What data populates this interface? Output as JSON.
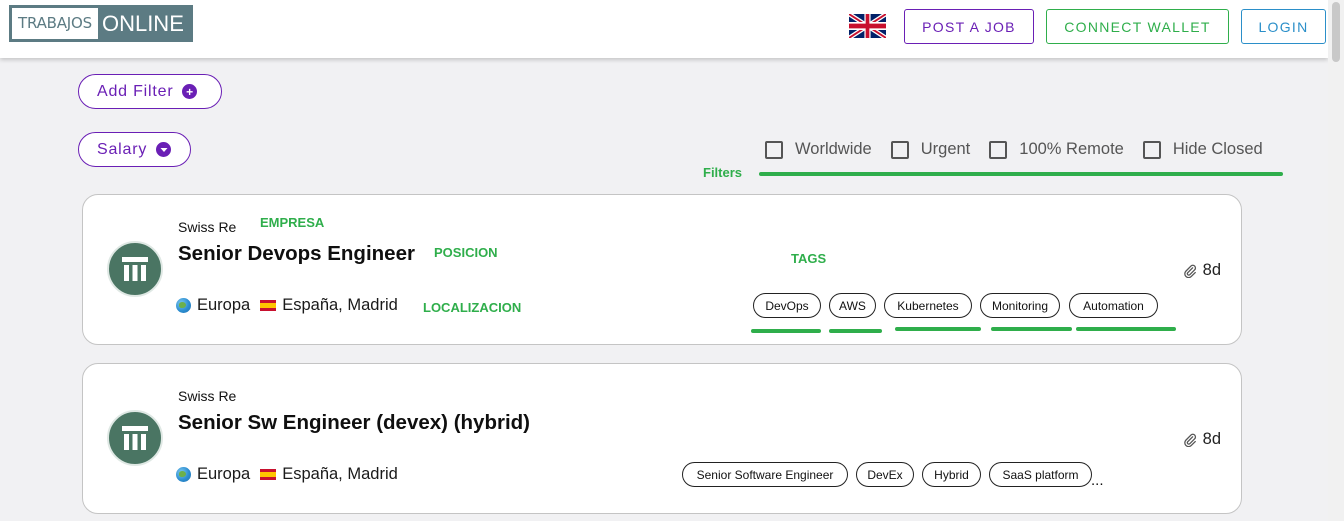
{
  "header": {
    "logo_left": "TRABAJOS",
    "logo_right": "ONLINE",
    "post_job": "POST A JOB",
    "connect_wallet": "CONNECT WALLET",
    "login": "LOGIN"
  },
  "filters": {
    "add_filter": "Add Filter",
    "salary": "Salary",
    "checkboxes": [
      "Worldwide",
      "Urgent",
      "100% Remote",
      "Hide Closed"
    ],
    "annotation": "Filters"
  },
  "annotations": {
    "empresa": "EMPRESA",
    "posicion": "POSICION",
    "tags": "TAGS",
    "localizacion": "LOCALIZACION"
  },
  "jobs": [
    {
      "company": "Swiss Re",
      "title": "Senior Devops Engineer",
      "region": "Europa",
      "location": "España, Madrid",
      "tags": [
        "DevOps",
        "AWS",
        "Kubernetes",
        "Monitoring",
        "Automation"
      ],
      "age": "8d"
    },
    {
      "company": "Swiss Re",
      "title": "Senior Sw Engineer (devex) (hybrid)",
      "region": "Europa",
      "location": "España, Madrid",
      "tags": [
        "Senior Software Engineer",
        "DevEx",
        "Hybrid",
        "SaaS platform"
      ],
      "more": "...",
      "age": "8d"
    }
  ],
  "colors": {
    "purple": "#6a1fb5",
    "green": "#2fae4b",
    "blue": "#2b8fc9",
    "logo": "#5c7b83",
    "avatar": "#4a7563"
  }
}
